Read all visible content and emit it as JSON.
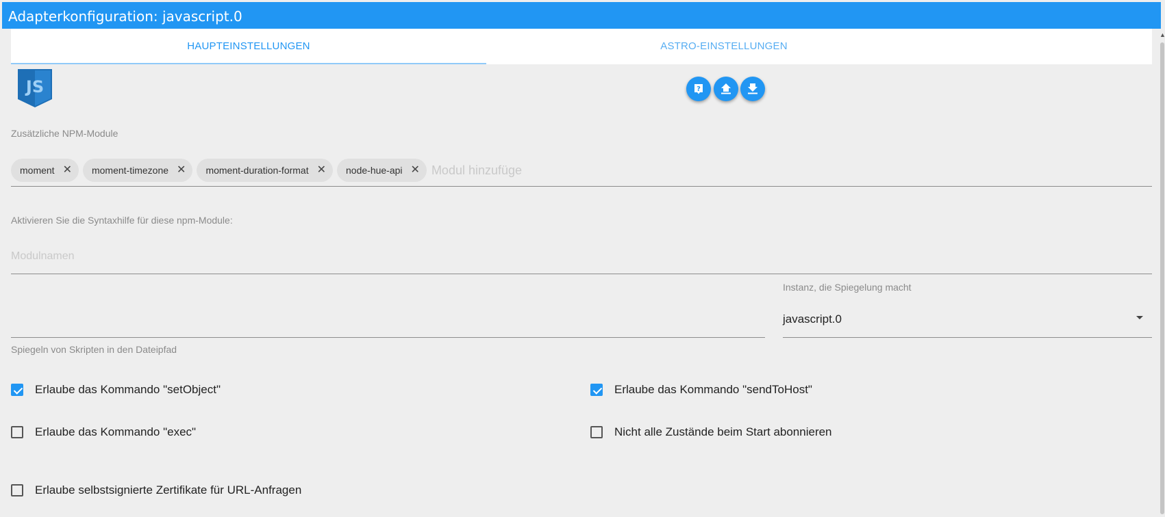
{
  "window": {
    "title": "Adapterkonfiguration: javascript.0"
  },
  "tabs": [
    {
      "label": "HAUPTEINSTELLUNGEN",
      "active": true
    },
    {
      "label": "ASTRO-EINSTELLUNGEN",
      "active": false
    }
  ],
  "logo": {
    "text": "JS"
  },
  "toolbar": {
    "buttons": [
      {
        "icon": "help-icon"
      },
      {
        "icon": "upload-icon"
      },
      {
        "icon": "download-icon"
      }
    ]
  },
  "npm": {
    "label": "Zusätzliche NPM-Module",
    "chips": [
      "moment",
      "moment-timezone",
      "moment-duration-format",
      "node-hue-api"
    ],
    "input_placeholder": "Modul hinzufüge"
  },
  "syntax": {
    "label": "Aktivieren Sie die Syntaxhilfe für diese npm-Module:",
    "placeholder": "Modulnamen"
  },
  "mirror": {
    "path_helper": "Spiegeln von Skripten in den Dateipfad",
    "instance_label": "Instanz, die Spiegelung macht",
    "instance_value": "javascript.0"
  },
  "checkboxes": {
    "setObject": {
      "label": "Erlaube das Kommando \"setObject\"",
      "checked": true
    },
    "sendToHost": {
      "label": "Erlaube das Kommando \"sendToHost\"",
      "checked": true
    },
    "exec": {
      "label": "Erlaube das Kommando \"exec\"",
      "checked": false
    },
    "subscribe": {
      "label": "Nicht alle Zustände beim Start abonnieren",
      "checked": false
    },
    "selfsigned": {
      "label": "Erlaube selbstsignierte Zertifikate für URL-Anfragen",
      "checked": false
    }
  },
  "colors": {
    "accent": "#2196f3",
    "background": "#eeeeee",
    "logo_blue": "#1e6fb6"
  }
}
